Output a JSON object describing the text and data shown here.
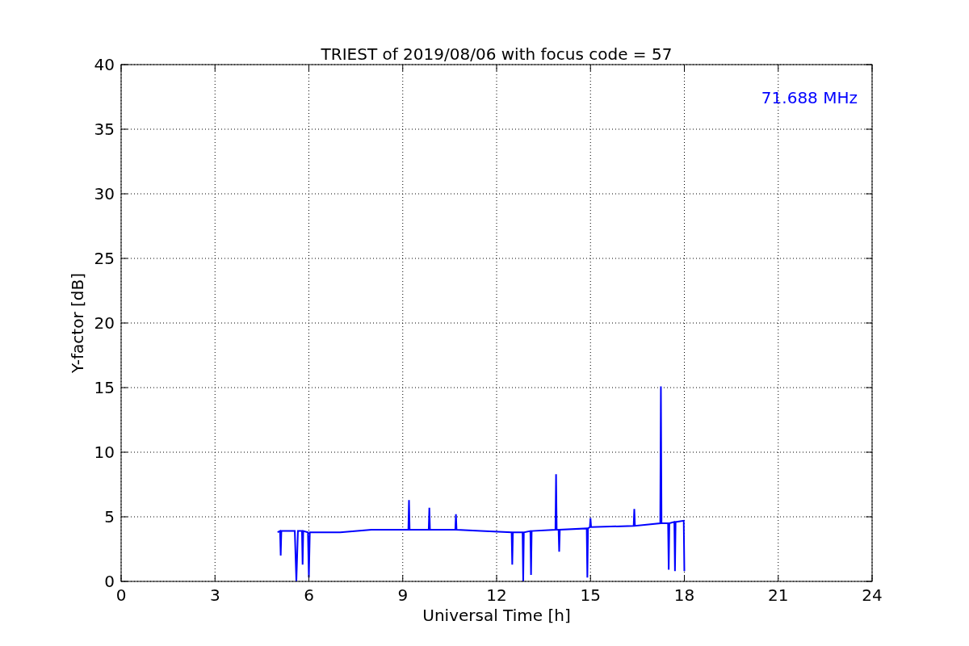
{
  "chart_data": {
    "type": "line",
    "title": "TRIEST of 2019/08/06 with focus code = 57",
    "xlabel": "Universal Time [h]",
    "ylabel": "Y-factor [dB]",
    "xlim": [
      0,
      24
    ],
    "ylim": [
      0,
      40
    ],
    "xticks": [
      0,
      3,
      6,
      9,
      12,
      15,
      18,
      21,
      24
    ],
    "yticks": [
      0,
      5,
      10,
      15,
      20,
      25,
      30,
      35,
      40
    ],
    "x": [
      5.0,
      5.08,
      5.1,
      5.12,
      5.55,
      5.6,
      5.65,
      5.78,
      5.8,
      5.82,
      5.97,
      6.0,
      6.03,
      7.0,
      8.0,
      9.18,
      9.2,
      9.22,
      9.83,
      9.85,
      9.87,
      10.68,
      10.7,
      10.72,
      11.5,
      12.48,
      12.5,
      12.52,
      12.83,
      12.85,
      12.87,
      13.08,
      13.1,
      13.12,
      13.88,
      13.9,
      13.92,
      13.98,
      14.0,
      14.02,
      14.88,
      14.9,
      14.92,
      14.98,
      15.0,
      15.02,
      16.38,
      16.4,
      16.42,
      17.23,
      17.25,
      17.27,
      17.48,
      17.5,
      17.52,
      17.68,
      17.7,
      17.72,
      17.98,
      18.0
    ],
    "series": [
      {
        "name": "71.688 MHz",
        "color": "#0000ff",
        "values": [
          3.8,
          3.9,
          2.0,
          3.9,
          3.9,
          0,
          3.9,
          3.9,
          1.3,
          3.9,
          3.8,
          0.3,
          3.8,
          3.8,
          4.0,
          4.0,
          6.3,
          4.0,
          4.0,
          5.7,
          4.0,
          4.0,
          5.2,
          4.0,
          3.9,
          3.8,
          1.3,
          3.8,
          3.8,
          0,
          3.8,
          3.9,
          0.5,
          3.9,
          4.0,
          8.3,
          4.0,
          4.0,
          2.3,
          4.0,
          4.1,
          0.3,
          4.1,
          4.2,
          4.9,
          4.2,
          4.3,
          5.6,
          4.3,
          4.5,
          15.1,
          4.5,
          4.5,
          0.9,
          4.5,
          4.6,
          0.8,
          4.6,
          4.7,
          0.8
        ]
      }
    ],
    "grid": true
  }
}
